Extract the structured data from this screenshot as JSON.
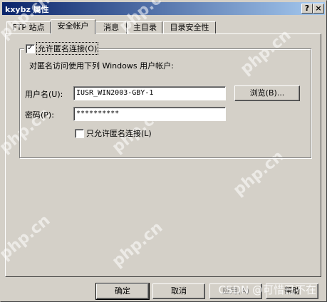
{
  "window": {
    "title": "kxybz 属性"
  },
  "titlebar_buttons": {
    "help": "?",
    "close": "×"
  },
  "tabs": [
    {
      "label": "FTP 站点"
    },
    {
      "label": "安全帐户"
    },
    {
      "label": "消息"
    },
    {
      "label": "主目录"
    },
    {
      "label": "目录安全性"
    }
  ],
  "anonymous": {
    "checkbox_label": "允许匿名连接(O)",
    "checked": true,
    "description": "对匿名访问使用下列 Windows 用户帐户:",
    "username_label": "用户名(U):",
    "username_value": "IUSR_WIN2003-GBY-1",
    "browse_label": "浏览(B)...",
    "password_label": "密码(P):",
    "password_value": "**********",
    "only_anonymous_label": "只允许匿名连接(L)",
    "only_anonymous_checked": false
  },
  "footer": {
    "ok": "确定",
    "cancel": "取消",
    "apply": "应用(A)",
    "help": "帮助"
  },
  "overlay": {
    "watermark": "php.cn",
    "csdn": "CSDN @可惜已不在"
  }
}
